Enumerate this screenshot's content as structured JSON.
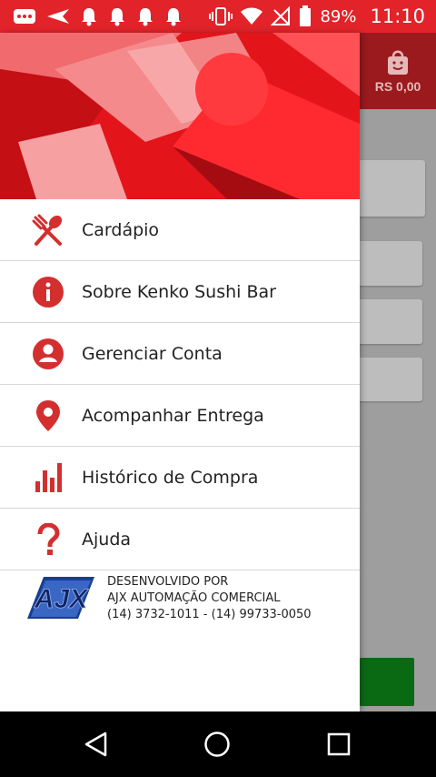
{
  "statusbar": {
    "battery_percent": "89%",
    "time": "11:10"
  },
  "cart": {
    "price": "RS 0,00"
  },
  "menu": {
    "items": [
      {
        "label": "Cardápio",
        "icon": "fork-spoon-icon"
      },
      {
        "label": "Sobre Kenko Sushi Bar",
        "icon": "info-icon"
      },
      {
        "label": "Gerenciar Conta",
        "icon": "account-icon"
      },
      {
        "label": "Acompanhar Entrega",
        "icon": "location-pin-icon"
      },
      {
        "label": "Histórico de Compra",
        "icon": "bar-chart-icon"
      },
      {
        "label": "Ajuda",
        "icon": "question-icon"
      }
    ]
  },
  "footer": {
    "logo_text": "AJX",
    "line1": "DESENVOLVIDO POR",
    "line2": "AJX AUTOMAÇÃO COMERCIAL",
    "line3": "(14) 3732-1011 - (14) 99733-0050"
  },
  "colors": {
    "accent": "#e2242a",
    "icon": "#d32f2f",
    "green": "#0a6a14"
  }
}
